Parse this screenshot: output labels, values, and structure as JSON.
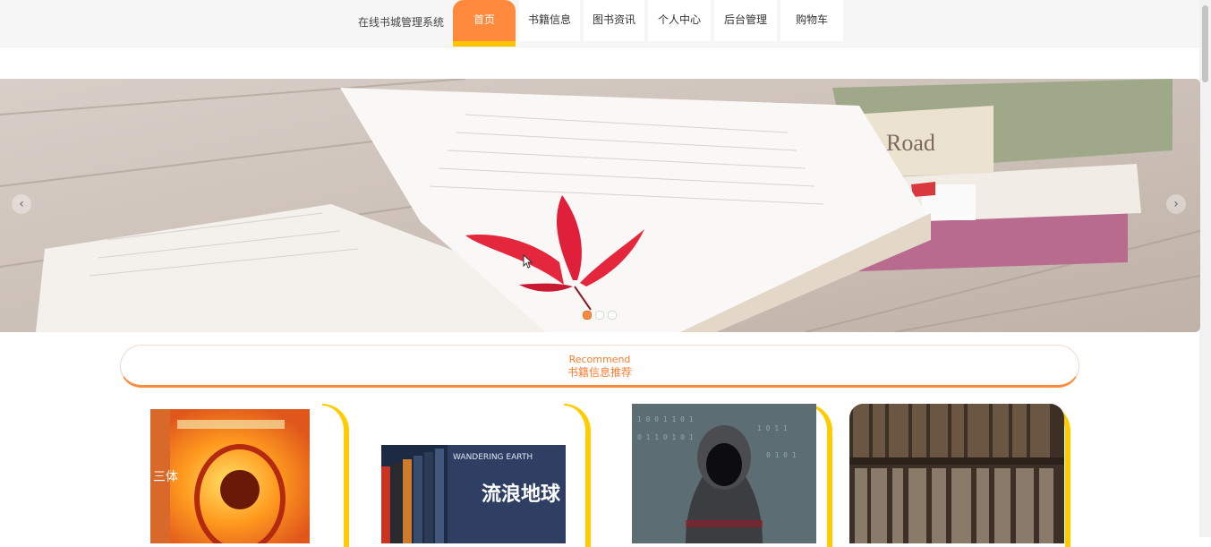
{
  "header": {
    "site_title": "在线书城管理系统",
    "nav": [
      "首页",
      "书籍信息",
      "图书资讯",
      "个人中心",
      "后台管理",
      "购物车"
    ],
    "active_index": 0,
    "accent_color": "#ff8a3d",
    "underline_color": "#ffc400"
  },
  "banner": {
    "prev_icon": "chevron-left-icon",
    "next_icon": "chevron-right-icon",
    "slide_count": 3,
    "active_slide": 0,
    "book_spine_text": "Road"
  },
  "recommend": {
    "title_en": "Recommend",
    "title_cn": "书籍信息推荐"
  },
  "books": [
    {
      "cover_title": "三体"
    },
    {
      "cover_title": "流浪地球",
      "cover_subtitle": "WANDERING EARTH"
    },
    {
      "cover_title": ""
    },
    {
      "cover_title": ""
    }
  ]
}
